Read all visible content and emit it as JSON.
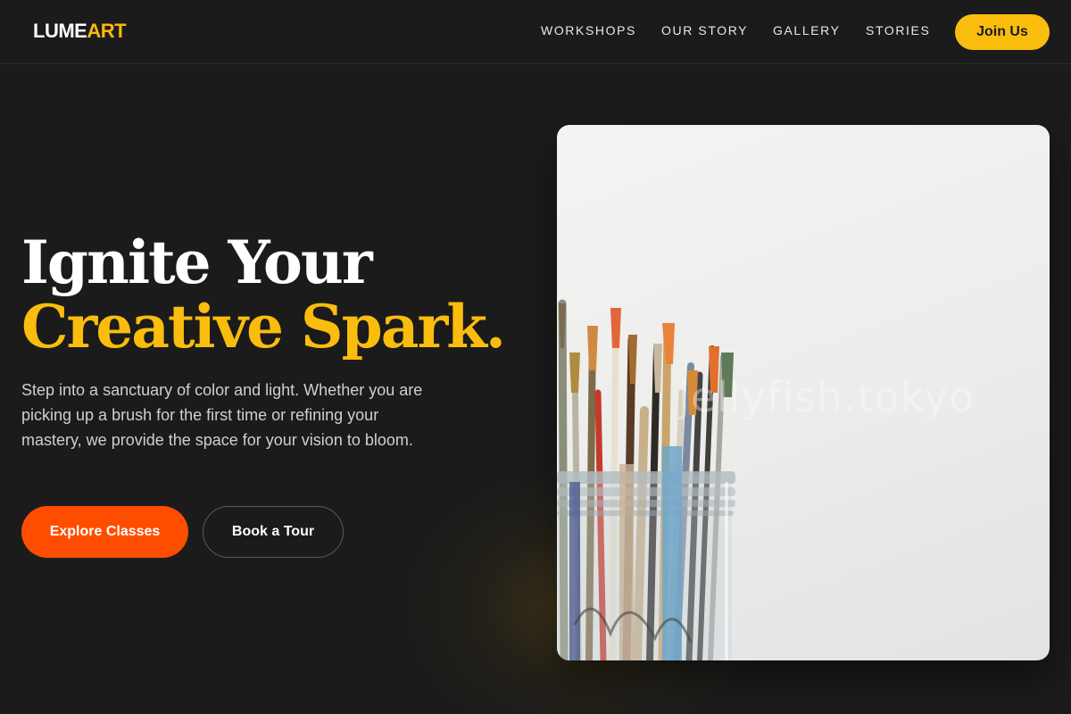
{
  "header": {
    "logo_part1": "LUME",
    "logo_part2": "ART",
    "nav": [
      "WORKSHOPS",
      "OUR STORY",
      "GALLERY",
      "STORIES"
    ],
    "cta": "Join Us"
  },
  "hero": {
    "title_line1": "Ignite Your",
    "title_line2": "Creative Spark.",
    "subtitle": "Step into a sanctuary of color and light. Whether you are picking up a brush for the first time or refining your mastery, we provide the space for your vision to bloom.",
    "primary_cta": "Explore Classes",
    "secondary_cta": "Book a Tour",
    "image_watermark": "jellyfish.tokyo"
  },
  "colors": {
    "background": "#1b1b1b",
    "accent_yellow": "#fbbd0d",
    "accent_orange": "#ff4d00"
  },
  "icons": {
    "hero_image": "paintbrushes-in-jar-photo"
  }
}
